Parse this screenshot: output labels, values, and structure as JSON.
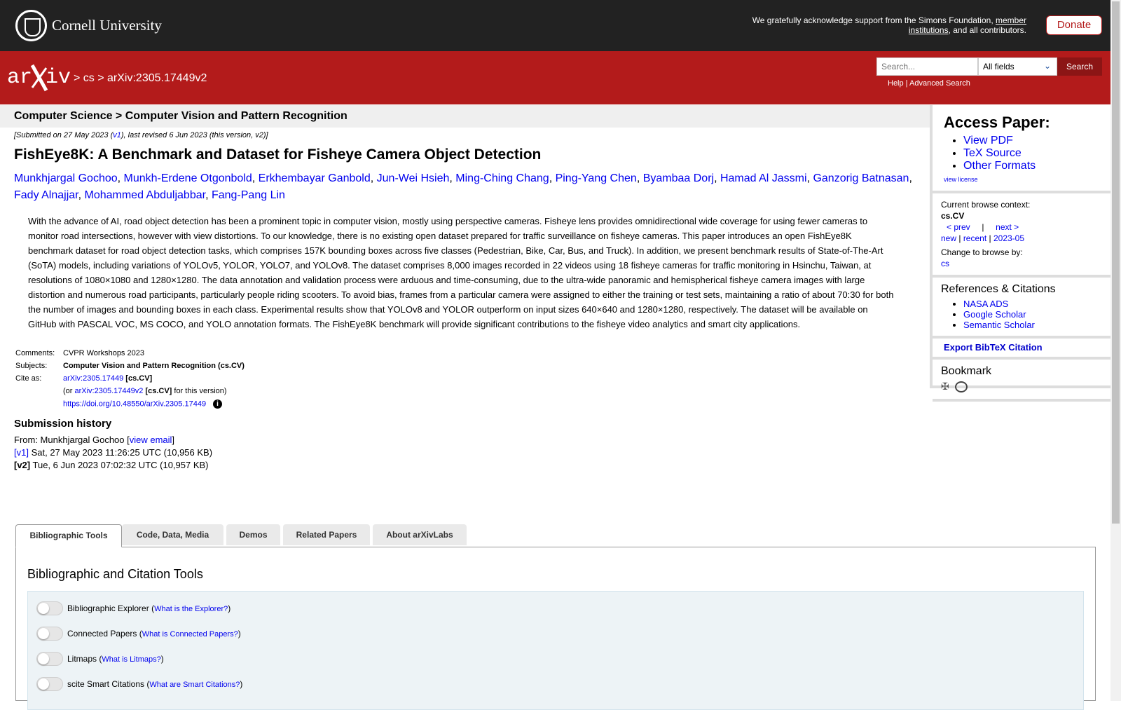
{
  "topbar": {
    "university": "Cornell University",
    "ack_prefix": "We gratefully acknowledge support from the Simons Foundation, ",
    "ack_link": "member institutions",
    "ack_suffix": ", and all contributors.",
    "donate": "Donate"
  },
  "header": {
    "crumb_sep1": " > ",
    "crumb_cs": "cs",
    "crumb_sep2": " > ",
    "crumb_id": "arXiv:2305.17449v2",
    "search_placeholder": "Search...",
    "search_field": "All fields",
    "search_button": "Search",
    "help": "Help",
    "help_sep": " | ",
    "advanced": "Advanced Search"
  },
  "subhead": "Computer Science > Computer Vision and Pattern Recognition",
  "paper": {
    "date_pre": "[Submitted on 27 May 2023 (",
    "date_v1": "v1",
    "date_post": "), last revised 6 Jun 2023 (this version, v2)]",
    "title": "FishEye8K: A Benchmark and Dataset for Fisheye Camera Object Detection",
    "authors": [
      "Munkhjargal Gochoo",
      "Munkh-Erdene Otgonbold",
      "Erkhembayar Ganbold",
      "Jun-Wei Hsieh",
      "Ming-Ching Chang",
      "Ping-Yang Chen",
      "Byambaa Dorj",
      "Hamad Al Jassmi",
      "Ganzorig Batnasan",
      "Fady Alnajjar",
      "Mohammed Abduljabbar",
      "Fang-Pang Lin"
    ],
    "abstract": "With the advance of AI, road object detection has been a prominent topic in computer vision, mostly using perspective cameras. Fisheye lens provides omnidirectional wide coverage for using fewer cameras to monitor road intersections, however with view distortions. To our knowledge, there is no existing open dataset prepared for traffic surveillance on fisheye cameras. This paper introduces an open FishEye8K benchmark dataset for road object detection tasks, which comprises 157K bounding boxes across five classes (Pedestrian, Bike, Car, Bus, and Truck). In addition, we present benchmark results of State-of-The-Art (SoTA) models, including variations of YOLOv5, YOLOR, YOLO7, and YOLOv8. The dataset comprises 8,000 images recorded in 22 videos using 18 fisheye cameras for traffic monitoring in Hsinchu, Taiwan, at resolutions of 1080×1080 and 1280×1280. The data annotation and validation process were arduous and time-consuming, due to the ultra-wide panoramic and hemispherical fisheye camera images with large distortion and numerous road participants, particularly people riding scooters. To avoid bias, frames from a particular camera were assigned to either the training or test sets, maintaining a ratio of about 70:30 for both the number of images and bounding boxes in each class. Experimental results show that YOLOv8 and YOLOR outperform on input sizes 640×640 and 1280×1280, respectively. The dataset will be available on GitHub with PASCAL VOC, MS COCO, and YOLO annotation formats. The FishEye8K benchmark will provide significant contributions to the fisheye video analytics and smart city applications.",
    "comments_label": "Comments:",
    "comments": "CVPR Workshops 2023",
    "subjects_label": "Subjects:",
    "subjects": "Computer Vision and Pattern Recognition (cs.CV)",
    "cite_label": "Cite as:",
    "cite_id": "arXiv:2305.17449",
    "cite_cat": " [cs.CV]",
    "cite_or": "(or ",
    "cite_v2": "arXiv:2305.17449v2",
    "cite_v2_cat": " [cs.CV]",
    "cite_v2_post": " for this version)",
    "doi": "https://doi.org/10.48550/arXiv.2305.17449"
  },
  "history": {
    "heading": "Submission history",
    "from": "From: Munkhjargal Gochoo [",
    "view_email": "view email",
    "from_end": "]",
    "v1_label": "[v1]",
    "v1": " Sat, 27 May 2023 11:26:25 UTC (10,956 KB)",
    "v2_label": "[v2]",
    "v2": " Tue, 6 Jun 2023 07:02:32 UTC (10,957 KB)"
  },
  "sidebar": {
    "access_title": "Access Paper:",
    "links": [
      "View PDF",
      "TeX Source",
      "Other Formats"
    ],
    "license": "view license",
    "context_label": "Current browse context:",
    "context": "cs.CV",
    "prev": "< prev",
    "sep": "|",
    "next": "next >",
    "new": "new",
    "recent": "recent",
    "month": "2023-05",
    "change": "Change to browse by:",
    "cs": "cs",
    "refs_title": "References & Citations",
    "refs": [
      "NASA ADS",
      "Google Scholar",
      "Semantic Scholar"
    ],
    "export": "Export BibTeX Citation",
    "bookmark": "Bookmark"
  },
  "tabs": [
    "Bibliographic Tools",
    "Code, Data, Media",
    "Demos",
    "Related Papers",
    "About arXivLabs"
  ],
  "panel": {
    "title": "Bibliographic and Citation Tools",
    "tools": [
      {
        "label": "Bibliographic Explorer",
        "link": "What is the Explorer?"
      },
      {
        "label": "Connected Papers",
        "link": "What is Connected Papers?"
      },
      {
        "label": "Litmaps",
        "link": "What is Litmaps?"
      },
      {
        "label": "scite Smart Citations",
        "link": "What are Smart Citations?"
      }
    ]
  }
}
